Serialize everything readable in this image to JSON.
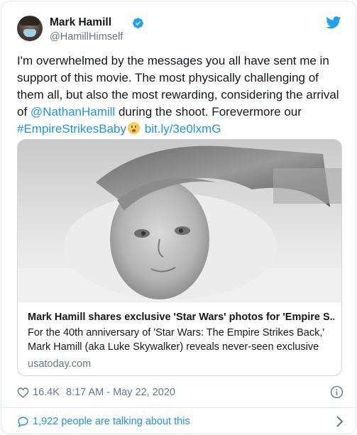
{
  "colors": {
    "link": "#1b95e0",
    "secondary_text": "#657786",
    "primary_text": "#14171a",
    "twitter_blue": "#1da1f2",
    "border": "#e1e8ed"
  },
  "author": {
    "display_name": "Mark Hamill",
    "handle": "@HamillHimself",
    "verified": true
  },
  "tweet": {
    "text_part1": "I'm overwhelmed by the messages you all have sent me in support of this movie. The most physically challenging of them all, but also the most rewarding, considering the arrival of ",
    "mention": "@NathanHamill",
    "text_part2": " during the shoot. Forevermore our ",
    "hashtag": "#EmpireStrikesBaby",
    "emoji": "baby-face-emoji",
    "short_link": "bit.ly/3e0lxmG"
  },
  "link_card": {
    "title": "Mark Hamill shares exclusive 'Star Wars' photos for 'Empire S...",
    "description": "For the 40th anniversary of 'Star Wars: The Empire Strikes Back,' Mark Hamill (aka Luke Skywalker) reveals never-seen exclusive",
    "domain": "usatoday.com"
  },
  "meta": {
    "like_count": "16.4K",
    "timestamp": "8:17 AM - May 22, 2020"
  },
  "footer": {
    "talking_text": "1,922 people are talking about this"
  }
}
